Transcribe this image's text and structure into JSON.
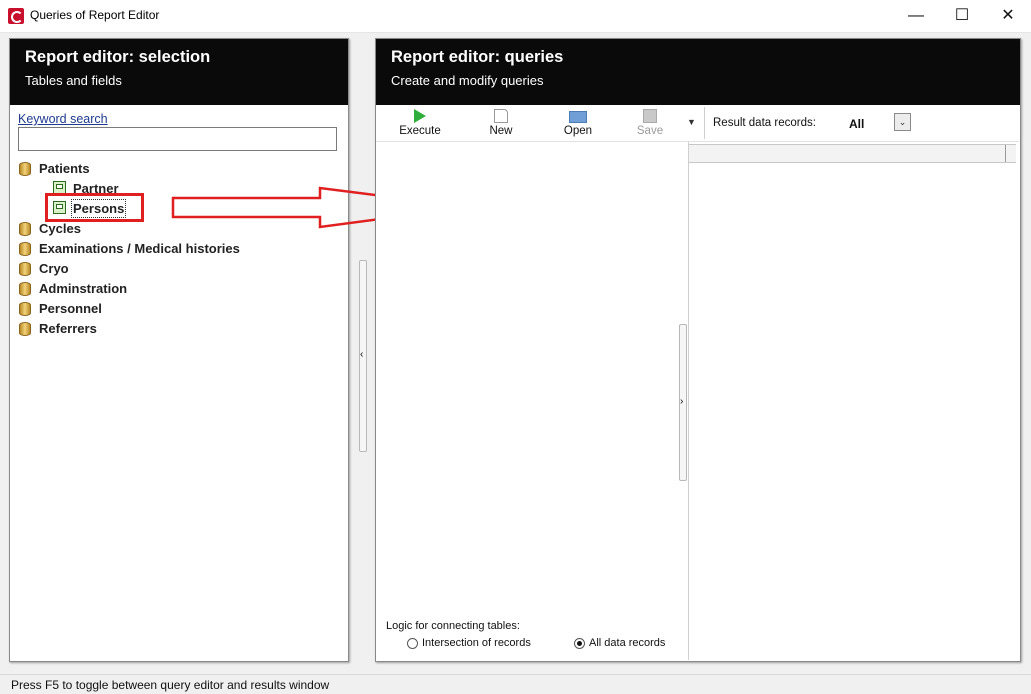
{
  "window": {
    "title": "Queries of Report Editor",
    "controls": {
      "minimize": "—",
      "maximize": "☐",
      "close": "✕"
    }
  },
  "left_panel": {
    "title": "Report editor: selection",
    "subtitle": "Tables and fields",
    "keyword_search": {
      "label": "Keyword search",
      "value": ""
    },
    "tree": [
      {
        "label": "Patients",
        "icon": "database-icon",
        "expanded": true,
        "children": [
          {
            "label": "Partner",
            "icon": "table-icon"
          },
          {
            "label": "Persons",
            "icon": "table-icon",
            "selected": true
          }
        ]
      },
      {
        "label": "Cycles",
        "icon": "database-icon"
      },
      {
        "label": "Examinations / Medical histories",
        "icon": "database-icon"
      },
      {
        "label": "Cryo",
        "icon": "database-icon"
      },
      {
        "label": "Adminstration",
        "icon": "database-icon"
      },
      {
        "label": "Personnel",
        "icon": "database-icon"
      },
      {
        "label": "Referrers",
        "icon": "database-icon"
      }
    ]
  },
  "right_panel": {
    "title": "Report editor: queries",
    "subtitle": "Create and modify queries",
    "toolbar": {
      "execute": "Execute",
      "new": "New",
      "open": "Open",
      "save": "Save",
      "result_records_label": "Result data records:",
      "result_records_value": "All"
    },
    "logic": {
      "label": "Logic for connecting tables:",
      "options": [
        "Intersection of records",
        "All data records"
      ],
      "selected": "All data records"
    }
  },
  "status_bar": {
    "text": "Press F5 to toggle between query editor and results window"
  },
  "colors": {
    "annotation": "#e02020",
    "header_bg": "#0a0a0a",
    "execute_icon": "#2fae3c"
  }
}
